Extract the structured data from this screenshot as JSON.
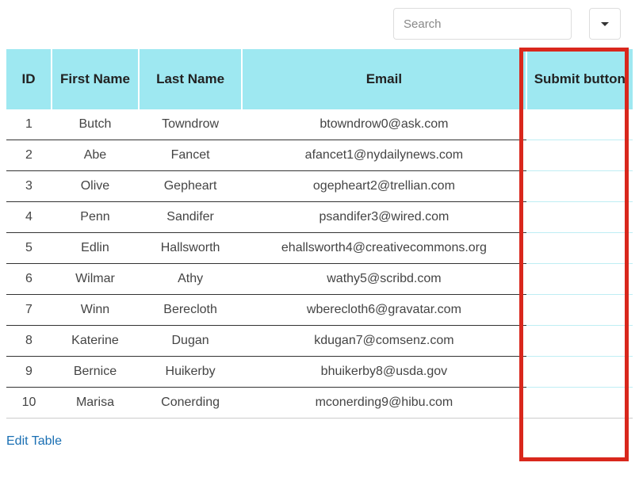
{
  "search": {
    "placeholder": "Search"
  },
  "table": {
    "headers": {
      "id": "ID",
      "first": "First Name",
      "last": "Last Name",
      "email": "Email",
      "submit": "Submit button"
    },
    "rows": [
      {
        "id": "1",
        "first": "Butch",
        "last": "Towndrow",
        "email": "btowndrow0@ask.com",
        "submit": ""
      },
      {
        "id": "2",
        "first": "Abe",
        "last": "Fancet",
        "email": "afancet1@nydailynews.com",
        "submit": ""
      },
      {
        "id": "3",
        "first": "Olive",
        "last": "Gepheart",
        "email": "ogepheart2@trellian.com",
        "submit": ""
      },
      {
        "id": "4",
        "first": "Penn",
        "last": "Sandifer",
        "email": "psandifer3@wired.com",
        "submit": ""
      },
      {
        "id": "5",
        "first": "Edlin",
        "last": "Hallsworth",
        "email": "ehallsworth4@creativecommons.org",
        "submit": ""
      },
      {
        "id": "6",
        "first": "Wilmar",
        "last": "Athy",
        "email": "wathy5@scribd.com",
        "submit": ""
      },
      {
        "id": "7",
        "first": "Winn",
        "last": "Berecloth",
        "email": "wberecloth6@gravatar.com",
        "submit": ""
      },
      {
        "id": "8",
        "first": "Katerine",
        "last": "Dugan",
        "email": "kdugan7@comsenz.com",
        "submit": ""
      },
      {
        "id": "9",
        "first": "Bernice",
        "last": "Huikerby",
        "email": "bhuikerby8@usda.gov",
        "submit": ""
      },
      {
        "id": "10",
        "first": "Marisa",
        "last": "Conerding",
        "email": "mconerding9@hibu.com",
        "submit": ""
      }
    ]
  },
  "links": {
    "edit_table": "Edit Table"
  },
  "highlight": {
    "color": "#d9271c"
  }
}
